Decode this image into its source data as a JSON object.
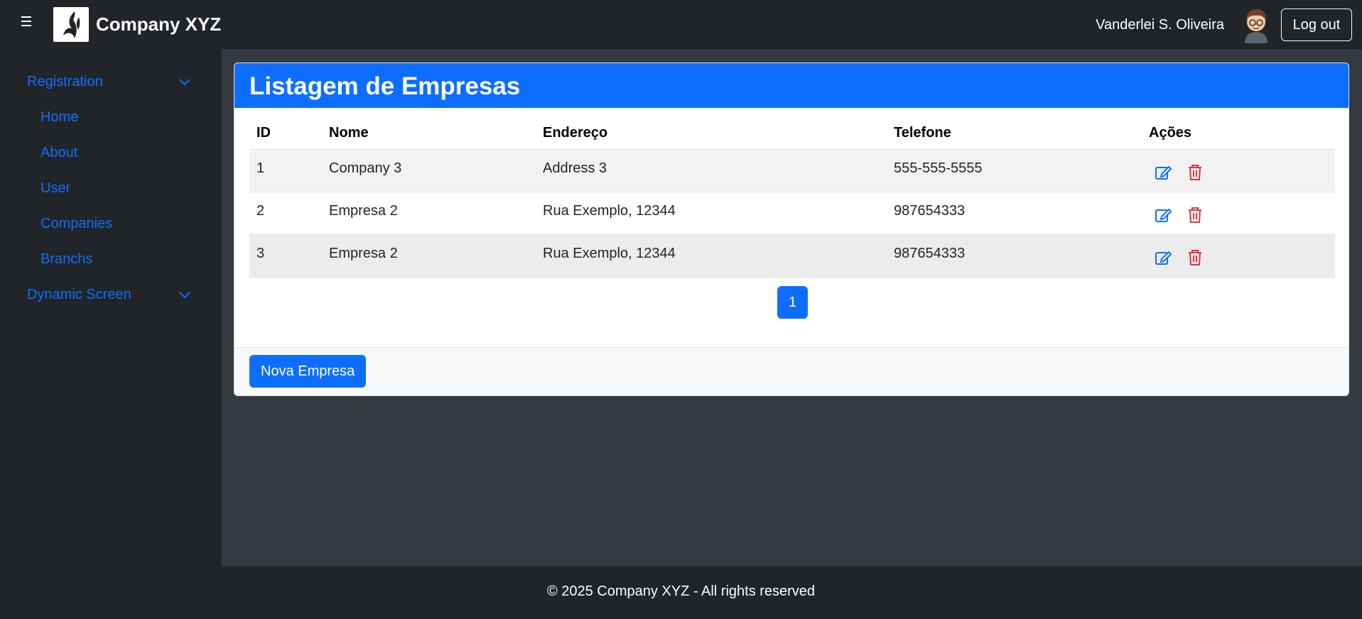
{
  "header": {
    "brand": "Company XYZ",
    "user_name": "Vanderlei S. Oliveira",
    "logout_label": "Log out"
  },
  "sidebar": {
    "sections": [
      {
        "label": "Registration"
      },
      {
        "label": "Dynamic Screen"
      }
    ],
    "items": [
      {
        "label": "Home"
      },
      {
        "label": "About"
      },
      {
        "label": "User"
      },
      {
        "label": "Companies"
      },
      {
        "label": "Branchs"
      }
    ]
  },
  "main": {
    "title": "Listagem de Empresas",
    "columns": [
      "ID",
      "Nome",
      "Endereço",
      "Telefone",
      "Ações"
    ],
    "rows": [
      {
        "id": "1",
        "nome": "Company 3",
        "endereco": "Address 3",
        "telefone": "555-555-5555"
      },
      {
        "id": "2",
        "nome": "Empresa 2",
        "endereco": "Rua Exemplo, 12344",
        "telefone": "987654333"
      },
      {
        "id": "3",
        "nome": "Empresa 2",
        "endereco": "Rua Exemplo, 12344",
        "telefone": "987654333"
      }
    ],
    "pagination": {
      "current": "1"
    },
    "new_button_label": "Nova Empresa"
  },
  "footer": {
    "text": "© 2025 Company XYZ - All rights reserved"
  },
  "colors": {
    "primary": "#0d6efd",
    "danger": "#dc3545",
    "dark": "#212529"
  },
  "icons": [
    "hamburger-icon",
    "logo-icon",
    "avatar",
    "chevron-down-icon",
    "edit-icon",
    "trash-icon"
  ]
}
